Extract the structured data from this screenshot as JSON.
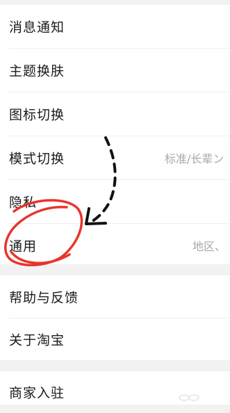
{
  "settings": {
    "group1": [
      {
        "label": "消息通知",
        "value": ""
      },
      {
        "label": "主题换肤",
        "value": ""
      },
      {
        "label": "图标切换",
        "value": ""
      },
      {
        "label": "模式切换",
        "value": "标准/长辈ン"
      },
      {
        "label": "隐私",
        "value": ""
      },
      {
        "label": "通用",
        "value": "地区、"
      }
    ],
    "group2": [
      {
        "label": "帮助与反馈",
        "value": ""
      },
      {
        "label": "关于淘宝",
        "value": ""
      }
    ],
    "group3": [
      {
        "label": "商家入驻",
        "value": ""
      }
    ]
  },
  "annotation": {
    "color": "#e8352b",
    "arrow_icon": "dashed-curved-arrow-icon",
    "circle_icon": "red-hand-drawn-circle"
  }
}
